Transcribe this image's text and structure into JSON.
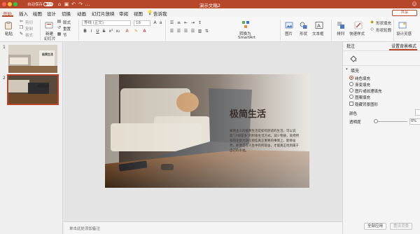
{
  "titlebar": {
    "autosave_label": "自动保存",
    "autosave_state": "关闭",
    "window_title": "演示文稿2"
  },
  "tabs": [
    "开始",
    "插入",
    "绘图",
    "设计",
    "切换",
    "动画",
    "幻灯片放映",
    "审阅",
    "视图",
    "告诉我"
  ],
  "share_label": "共享",
  "ribbon": {
    "paste": "粘贴",
    "cut": "剪切",
    "copy": "复制",
    "format": "格式",
    "new_slide_line1": "新建",
    "new_slide_line2": "幻灯片",
    "layout": "版式",
    "reset": "重置",
    "section": "节",
    "font_name": "等线 (正文)",
    "font_size": "18",
    "convert_line1": "转换为",
    "convert_line2": "SmartArt",
    "picture": "图片",
    "shapes": "形状",
    "textbox": "文本框",
    "arrange": "排列",
    "quick_styles": "快速样式",
    "shape_fill": "形状填充",
    "shape_outline": "形状轮廓",
    "design_ideas": "设计灵感",
    "format_pane": "格式窗格"
  },
  "thumbnails": [
    {
      "number": "1",
      "title": "极简生活"
    },
    {
      "number": "2",
      "title": "极简生活"
    }
  ],
  "slide": {
    "title": "极简生活",
    "body": "极简主义的极简生活是如何舒适的生活。可以说是“少即是多”的积极生活方式。减少物质，就把所有的注意力放在那些真正重要的事情上，能够舍弃，即便是在人生中有所取舍，才能真正找到属于自己的幸福。"
  },
  "notes_placeholder": "单击此处添加备注",
  "panel": {
    "tab_comments": "批注",
    "tab_format_bg": "设置背景格式",
    "section_fill": "填充",
    "options": [
      "纯色填充",
      "渐变填充",
      "图片或纹理填充",
      "图案填充"
    ],
    "selected_option": "纯色填充",
    "hide_bg_graphics": "隐藏背景图形",
    "color_label": "颜色",
    "transparency_label": "透明度",
    "transparency_value": "0%",
    "apply_all": "全部应用",
    "reset_bg": "重设背景"
  },
  "colors": {
    "accent": "#b7472a",
    "slide_title": "#3a2e28"
  }
}
